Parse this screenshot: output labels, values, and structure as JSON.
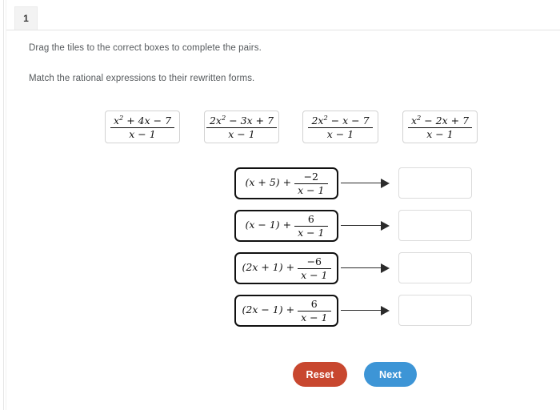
{
  "tab": {
    "label": "1"
  },
  "instructions": {
    "line1": "Drag the tiles to the correct boxes to complete the pairs.",
    "line2": "Match the rational expressions to their rewritten forms."
  },
  "tiles": [
    {
      "numerator": "x² + 4x − 7",
      "denominator": "x − 1",
      "num_coeff": "",
      "num_x2": "x",
      "num_rest": "+ 4x − 7"
    },
    {
      "numerator": "2x² − 3x + 7",
      "denominator": "x − 1",
      "num_coeff": "2",
      "num_x2": "x",
      "num_rest": "− 3x + 7"
    },
    {
      "numerator": "2x² − x − 7",
      "denominator": "x − 1",
      "num_coeff": "2",
      "num_x2": "x",
      "num_rest": "− x − 7"
    },
    {
      "numerator": "x² − 2x + 7",
      "denominator": "x − 1",
      "num_coeff": "",
      "num_x2": "x",
      "num_rest": "− 2x + 7"
    }
  ],
  "rows": [
    {
      "expression": "(x + 5) + (−2)/(x − 1)",
      "binomial": "(x + 5) +",
      "frac_numerator": "−2",
      "frac_denominator": "x − 1",
      "arrow": "arrow-right",
      "drop_value": ""
    },
    {
      "expression": "(x − 1) + 6/(x − 1)",
      "binomial": "(x − 1) +",
      "frac_numerator": "6",
      "frac_denominator": "x − 1",
      "arrow": "arrow-right",
      "drop_value": ""
    },
    {
      "expression": "(2x + 1) + (−6)/(x − 1)",
      "binomial": "(2x + 1) +",
      "frac_numerator": "−6",
      "frac_denominator": "x − 1",
      "arrow": "arrow-right",
      "drop_value": ""
    },
    {
      "expression": "(2x − 1) + 6/(x − 1)",
      "binomial": "(2x − 1) +",
      "frac_numerator": "6",
      "frac_denominator": "x − 1",
      "arrow": "arrow-right",
      "drop_value": ""
    }
  ],
  "buttons": {
    "reset": {
      "label": "Reset",
      "color": "#c8472f"
    },
    "next": {
      "label": "Next",
      "color": "#3d95d6"
    }
  }
}
